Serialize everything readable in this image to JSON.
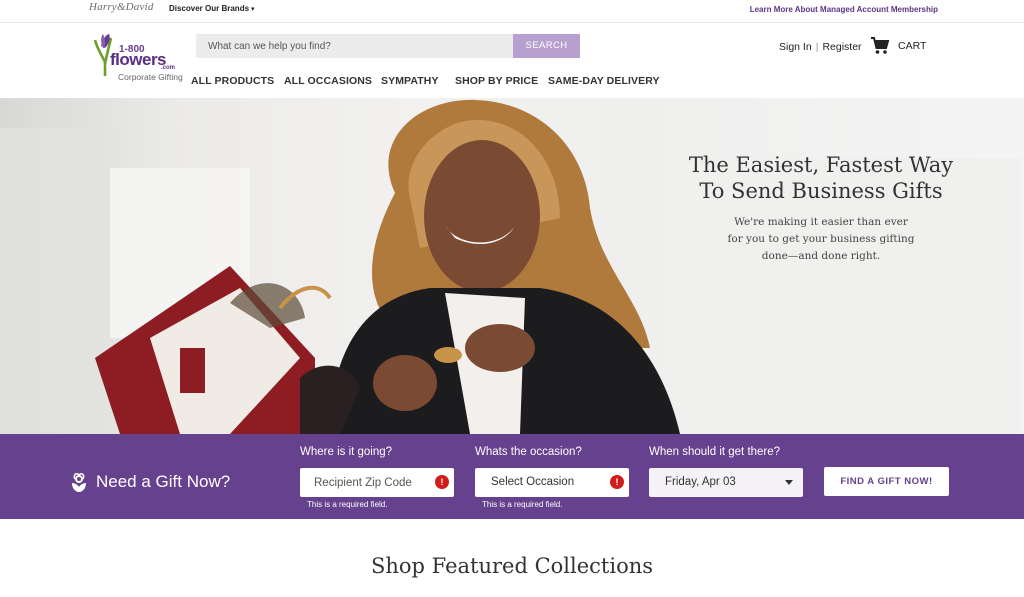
{
  "utility": {
    "hd_logo": "Harry&David",
    "brands_label": "Discover Our Brands",
    "managed_link": "Learn More About Managed Account Membership"
  },
  "header": {
    "logo": {
      "number": "1-800",
      "word": "flowers",
      "com": ".com",
      "sub": "Corporate Gifting"
    },
    "search": {
      "placeholder": "What can we help you find?",
      "button": "SEARCH"
    },
    "nav": [
      "ALL PRODUCTS",
      "ALL OCCASIONS",
      "SYMPATHY",
      "SHOP BY PRICE",
      "SAME-DAY DELIVERY"
    ],
    "sign_in": "Sign In",
    "register": "Register",
    "cart": "CART"
  },
  "hero": {
    "title_lines": [
      "The Easiest, Fastest Way",
      "To Send Business Gifts"
    ],
    "sub_lines": [
      "We're making it easier than ever",
      "for you to get your business gifting",
      "done—and done right."
    ]
  },
  "gift_finder": {
    "title": "Need a Gift Now?",
    "zip_label": "Where is it going?",
    "zip_placeholder": "Recipient Zip Code",
    "occasion_label": "Whats the occasion?",
    "occasion_value": "Select Occasion",
    "date_label": "When should it get there?",
    "date_value": "Friday, Apr 03",
    "required_msg": "This is a required field.",
    "error_symbol": "!",
    "button": "FIND A GIFT NOW!"
  },
  "featured_title": "Shop Featured Collections",
  "colors": {
    "brand_purple": "#66418e",
    "search_button": "#b79fcf",
    "error_red": "#d21c1c"
  }
}
